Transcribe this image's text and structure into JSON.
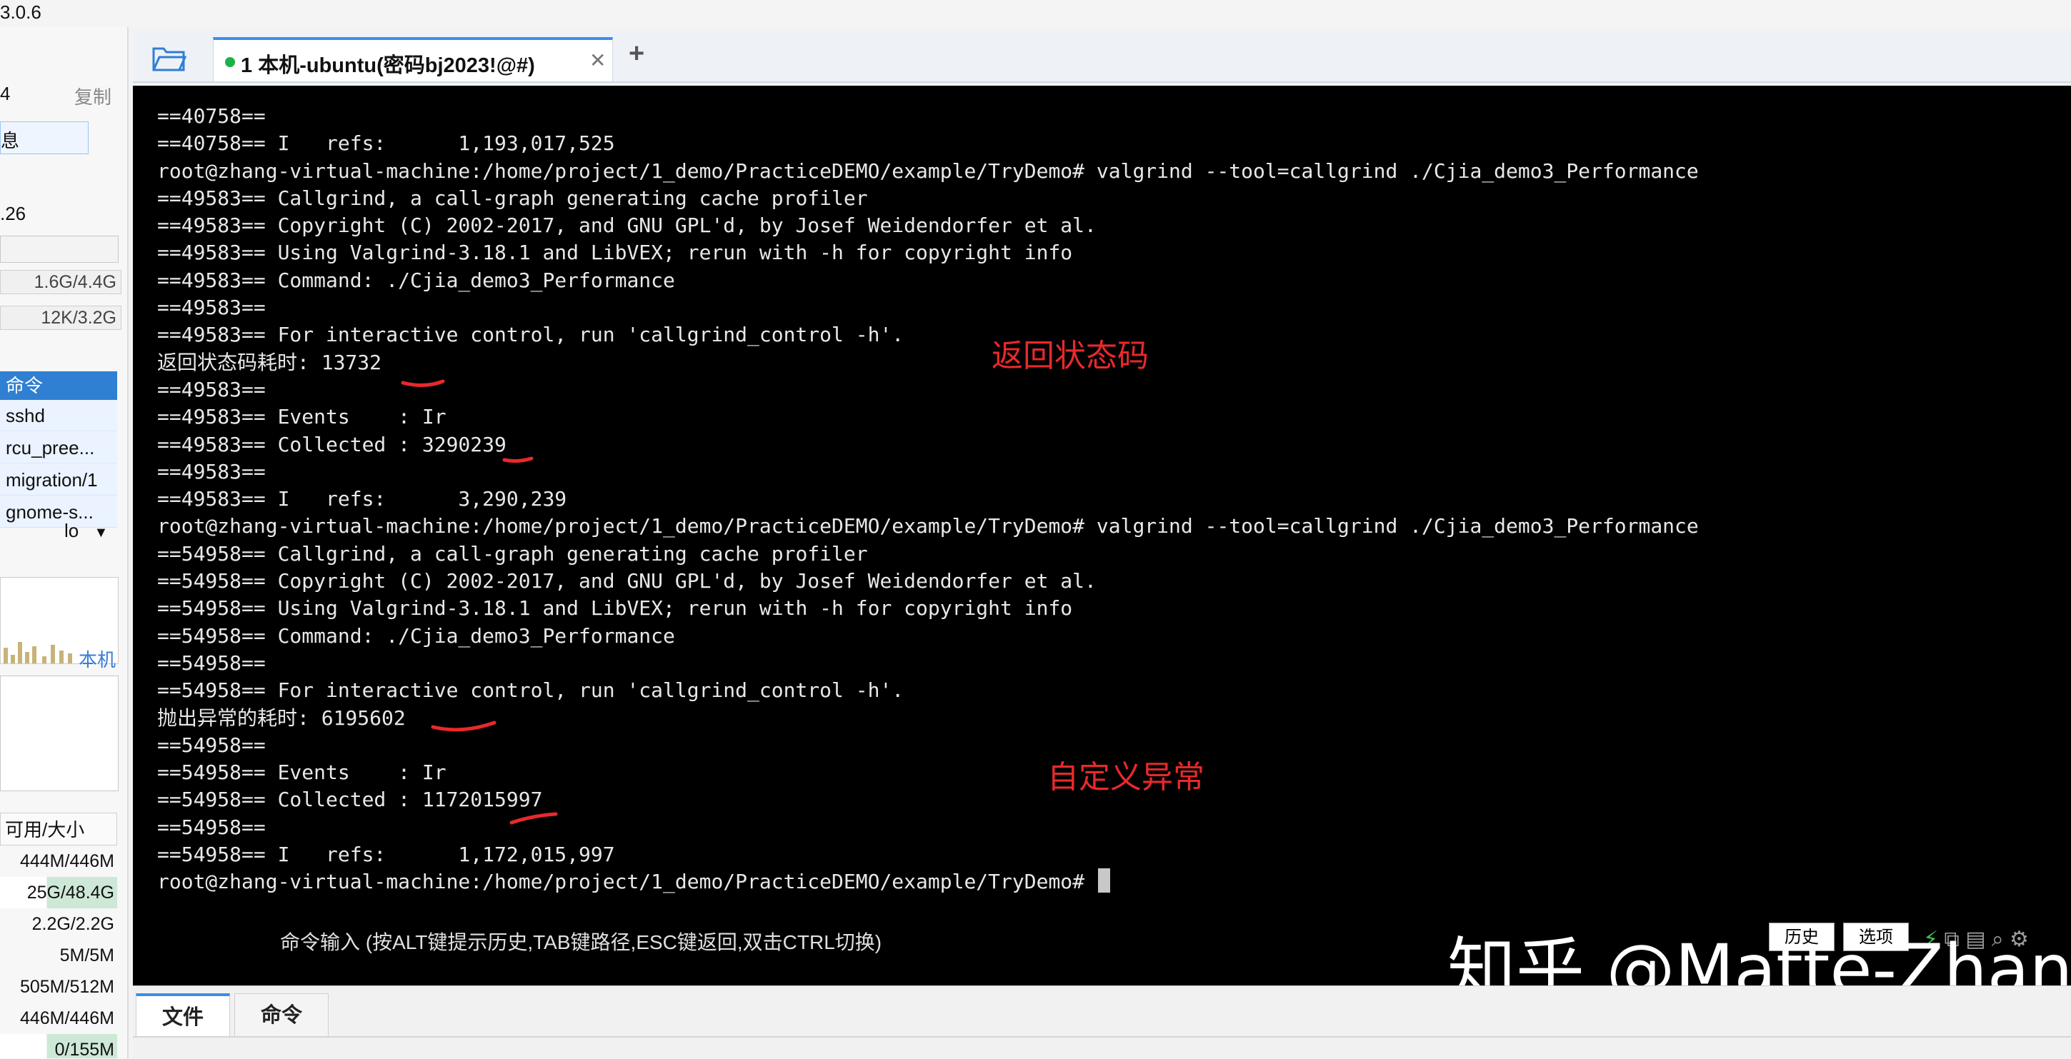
{
  "app": {
    "version_fragment": "3.0.6"
  },
  "sidebar": {
    "count_partial": "4",
    "copy_label": "复制",
    "info_label": "息",
    "load_partial": ".26",
    "memory": [
      "1.6G/4.4G",
      "12K/3.2G"
    ],
    "process_header": "命令",
    "processes": [
      "sshd",
      "rcu_pree...",
      "migration/1",
      "gnome-s..."
    ],
    "net_interface": "lo",
    "host_label": "本机",
    "disk_header": "可用/大小",
    "disks": [
      "444M/446M",
      "25G/48.4G",
      "2.2G/2.2G",
      "5M/5M",
      "505M/512M",
      "446M/446M",
      "0/155M"
    ]
  },
  "tabs": [
    {
      "number": "1",
      "title": "本机-ubuntu(密码bj2023!@#)",
      "status_color": "#19b34a"
    }
  ],
  "terminal": {
    "lines": [
      "==40758==",
      "==40758== I   refs:      1,193,017,525",
      "root@zhang-virtual-machine:/home/project/1_demo/PracticeDEMO/example/TryDemo# valgrind --tool=callgrind ./Cjia_demo3_Performance",
      "==49583== Callgrind, a call-graph generating cache profiler",
      "==49583== Copyright (C) 2002-2017, and GNU GPL'd, by Josef Weidendorfer et al.",
      "==49583== Using Valgrind-3.18.1 and LibVEX; rerun with -h for copyright info",
      "==49583== Command: ./Cjia_demo3_Performance",
      "==49583==",
      "==49583== For interactive control, run 'callgrind_control -h'.",
      "返回状态码耗时: 13732",
      "==49583==",
      "==49583== Events    : Ir",
      "==49583== Collected : 3290239",
      "==49583==",
      "==49583== I   refs:      3,290,239",
      "root@zhang-virtual-machine:/home/project/1_demo/PracticeDEMO/example/TryDemo# valgrind --tool=callgrind ./Cjia_demo3_Performance",
      "==54958== Callgrind, a call-graph generating cache profiler",
      "==54958== Copyright (C) 2002-2017, and GNU GPL'd, by Josef Weidendorfer et al.",
      "==54958== Using Valgrind-3.18.1 and LibVEX; rerun with -h for copyright info",
      "==54958== Command: ./Cjia_demo3_Performance",
      "==54958==",
      "==54958== For interactive control, run 'callgrind_control -h'.",
      "抛出异常的耗时: 6195602",
      "==54958==",
      "==54958== Events    : Ir",
      "==54958== Collected : 1172015997",
      "==54958==",
      "==54958== I   refs:      1,172,015,997",
      "root@zhang-virtual-machine:/home/project/1_demo/PracticeDEMO/example/TryDemo# "
    ],
    "annotations": [
      "返回状态码",
      "自定义异常"
    ],
    "annotation_color": "#e8292b",
    "command_hint": "命令输入 (按ALT键提示历史,TAB键路径,ESC键返回,双击CTRL切换)",
    "history_button": "历史",
    "option_button": "选项",
    "watermark": "知乎 @Matte-Zhang"
  },
  "bottom_tabs": [
    "文件",
    "命令"
  ],
  "accent_color": "#3a8ee6"
}
